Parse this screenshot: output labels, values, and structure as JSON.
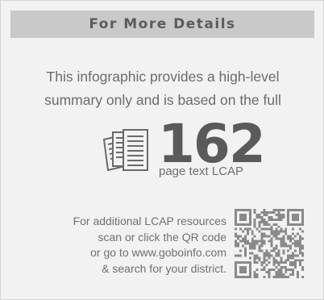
{
  "header": {
    "title": "For More Details"
  },
  "intro": {
    "line1": "This infographic provides a high-level",
    "line2": "summary only and is based on the full"
  },
  "doc_icon": {
    "icon": "documents-icon"
  },
  "page_count": {
    "number": "162",
    "caption": "page text LCAP"
  },
  "resources": {
    "line1": "For additional LCAP resources",
    "line2": "scan or click the QR code",
    "line3": "or go to www.goboinfo.com",
    "line4": "& search for your district."
  },
  "qr": {
    "icon": "qr-code-icon"
  },
  "colors": {
    "panel": "#f2f2f2",
    "header": "#c9c9c9",
    "header_text": "#5c5c5c",
    "body_text": "#6b6b6b",
    "qr": "#8a8a8a"
  }
}
